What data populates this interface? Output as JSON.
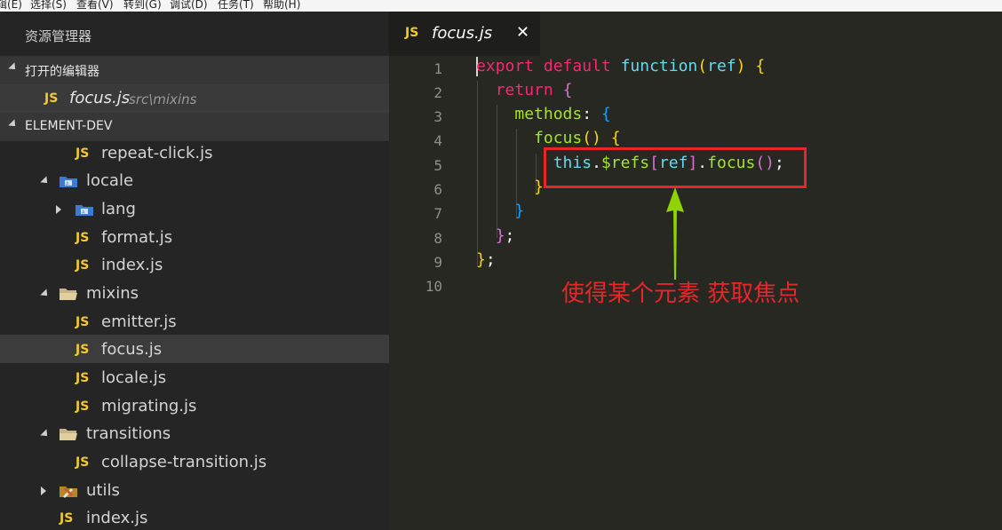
{
  "menubar": {
    "items": [
      "辑(E)",
      "选择(S)",
      "查看(V)",
      "转到(G)",
      "调试(D)",
      "任务(T)",
      "帮助(H)"
    ]
  },
  "sidebar": {
    "title": "资源管理器",
    "open_editors_header": "打开的编辑器",
    "open_editor": {
      "badge": "JS",
      "name": "focus.js",
      "path": "src\\mixins"
    },
    "project_header": "ELEMENT-DEV",
    "tree": [
      {
        "label": "repeat-click.js",
        "type": "js"
      },
      {
        "label": "locale",
        "type": "folder-open"
      },
      {
        "label": "lang",
        "type": "folder-closed"
      },
      {
        "label": "format.js",
        "type": "js"
      },
      {
        "label": "index.js",
        "type": "js"
      },
      {
        "label": "mixins",
        "type": "folder-open"
      },
      {
        "label": "emitter.js",
        "type": "js"
      },
      {
        "label": "focus.js",
        "type": "js",
        "selected": true
      },
      {
        "label": "locale.js",
        "type": "js"
      },
      {
        "label": "migrating.js",
        "type": "js"
      },
      {
        "label": "transitions",
        "type": "folder-open"
      },
      {
        "label": "collapse-transition.js",
        "type": "js"
      },
      {
        "label": "utils",
        "type": "folder-closed"
      },
      {
        "label": "index.js",
        "type": "js"
      }
    ]
  },
  "editor": {
    "tab": {
      "badge": "JS",
      "label": "focus.js",
      "close": "✕"
    },
    "line_numbers": [
      "1",
      "2",
      "3",
      "4",
      "5",
      "6",
      "7",
      "8",
      "9",
      "10"
    ],
    "code": [
      "export default function(ref) {",
      "  return {",
      "    methods: {",
      "      focus() {",
      "        this.$refs[ref].focus();",
      "      }",
      "    }",
      "  };",
      "};",
      ""
    ]
  },
  "annotation": {
    "text": "使得某个元素 获取焦点",
    "color": "#e7262a",
    "arrow_color": "#8fd400"
  }
}
